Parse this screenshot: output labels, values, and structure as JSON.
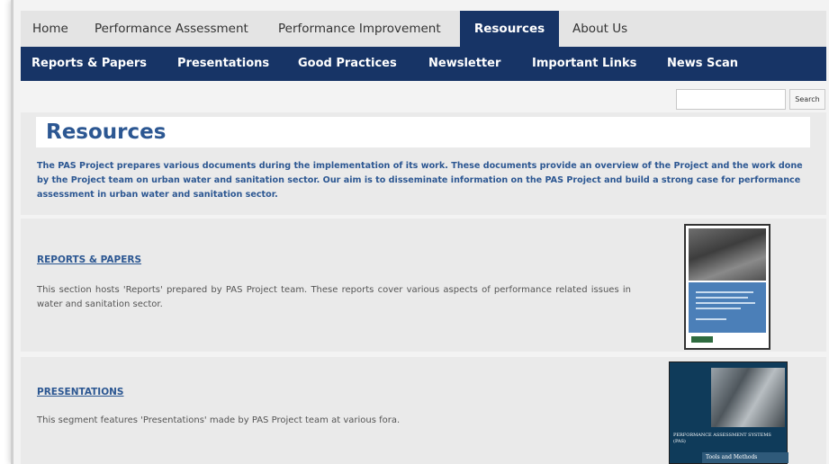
{
  "nav": {
    "top": [
      {
        "label": "Home"
      },
      {
        "label": "Performance Assessment"
      },
      {
        "label": "Performance Improvement"
      },
      {
        "label": "Resources"
      },
      {
        "label": "About Us"
      }
    ],
    "active_top": "Resources",
    "sub": [
      {
        "label": "Reports & Papers"
      },
      {
        "label": "Presentations"
      },
      {
        "label": "Good Practices"
      },
      {
        "label": "Newsletter"
      },
      {
        "label": "Important Links"
      },
      {
        "label": "News Scan"
      }
    ]
  },
  "search": {
    "placeholder": "",
    "button_label": "Search"
  },
  "page": {
    "title": "Resources",
    "intro": "The PAS Project prepares various documents during the implementation of its work. These documents provide an overview of the Project and the work done by the Project team on urban water and sanitation sector. Our aim is to disseminate information on the PAS Project and build a strong case for performance assessment in urban water and sanitation sector."
  },
  "sections": [
    {
      "heading": "REPORTS & PAPERS",
      "text": "This section hosts 'Reports' prepared by PAS Project team. These reports cover various aspects of performance related issues in water and sanitation sector."
    },
    {
      "heading": "PRESENTATIONS",
      "text": "This segment features 'Presentations' made by PAS Project team at various fora.",
      "thumb_title": "PERFORMANCE ASSESSMENT SYSTEMS (PAS)",
      "thumb_subtitle": "Tools and Methods"
    }
  ],
  "colors": {
    "nav_dark": "#173466",
    "heading_blue": "#2c5792"
  }
}
